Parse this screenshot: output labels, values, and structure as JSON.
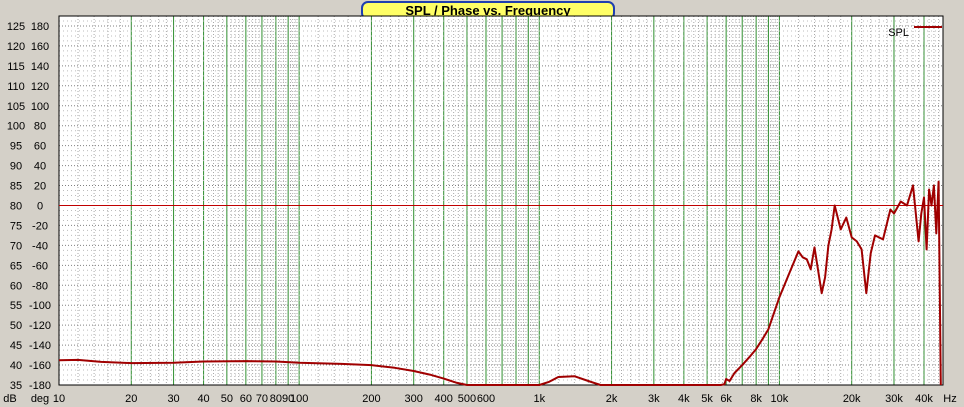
{
  "chart_data": {
    "type": "line",
    "title": "SPL / Phase vs. Frequency",
    "x_scale": "log",
    "xlim": [
      10,
      48000
    ],
    "xlabel_unit": "Hz",
    "x_ticks": [
      10,
      20,
      30,
      40,
      50,
      60,
      70,
      80,
      90,
      100,
      200,
      300,
      400,
      500,
      600,
      1000,
      2000,
      3000,
      4000,
      5000,
      6000,
      8000,
      10000,
      20000,
      30000,
      40000
    ],
    "x_tick_labels": [
      "10",
      "20",
      "30",
      "40",
      "50",
      "60",
      "70",
      "80",
      "90",
      "100",
      "200",
      "300",
      "400",
      "500",
      "600",
      "1k",
      "2k",
      "3k",
      "4k",
      "5k",
      "6k",
      "8k",
      "10k",
      "20k",
      "30k",
      "40k"
    ],
    "y_left_unit": "dB",
    "y_left_ticks": [
      "35",
      "40",
      "45",
      "50",
      "55",
      "60",
      "65",
      "70",
      "75",
      "80",
      "85",
      "90",
      "95",
      "100",
      "105",
      "110",
      "115",
      "120",
      "125"
    ],
    "ylim": [
      35,
      127.5
    ],
    "y_right_unit": "deg",
    "y_right_ticks": [
      "-180",
      "-160",
      "-140",
      "-120",
      "-100",
      "-80",
      "-60",
      "-40",
      "-20",
      "0",
      "20",
      "40",
      "60",
      "80",
      "100",
      "120",
      "140",
      "160",
      "180"
    ],
    "y_right_lim": [
      -180,
      190
    ],
    "grid": true,
    "legend_position": "top-right",
    "reference_line": 80,
    "series": [
      {
        "name": "SPL",
        "color": "#a00000",
        "x": [
          10,
          12,
          15,
          20,
          30,
          40,
          60,
          80,
          100,
          150,
          200,
          250,
          300,
          350,
          400,
          450,
          500,
          600,
          800,
          1000,
          1100,
          1200,
          1400,
          1600,
          1800,
          2000,
          3000,
          4000,
          5000,
          5700,
          5900,
          6000,
          6200,
          6500,
          7000,
          7500,
          8000,
          8500,
          9000,
          10000,
          11000,
          12000,
          12500,
          13000,
          13500,
          14000,
          15000,
          15500,
          16000,
          16500,
          17000,
          18000,
          19000,
          20000,
          21000,
          22000,
          23000,
          24000,
          25000,
          27000,
          29000,
          30000,
          32000,
          34000,
          36000,
          38000,
          39000,
          40000,
          41000,
          42000,
          43000,
          44000,
          45000,
          46000,
          47000
        ],
        "y": [
          41.2,
          41.3,
          40.8,
          40.5,
          40.6,
          40.9,
          41,
          40.9,
          40.6,
          40.3,
          40,
          39.3,
          38.5,
          37.6,
          36.6,
          35.6,
          35,
          35,
          35,
          35,
          35.8,
          37,
          37.2,
          36,
          35,
          35,
          35,
          35,
          35,
          35,
          35.2,
          36.5,
          36,
          38,
          40,
          42,
          44,
          46.5,
          49,
          57,
          63,
          68.5,
          67,
          66.5,
          64,
          69.5,
          58,
          62,
          70,
          74,
          80,
          74,
          77,
          72,
          71,
          69,
          58,
          68,
          72.5,
          71.5,
          79,
          78,
          81,
          80,
          85,
          71,
          78,
          82,
          69,
          84,
          80,
          85,
          73,
          86,
          35
        ]
      }
    ]
  }
}
